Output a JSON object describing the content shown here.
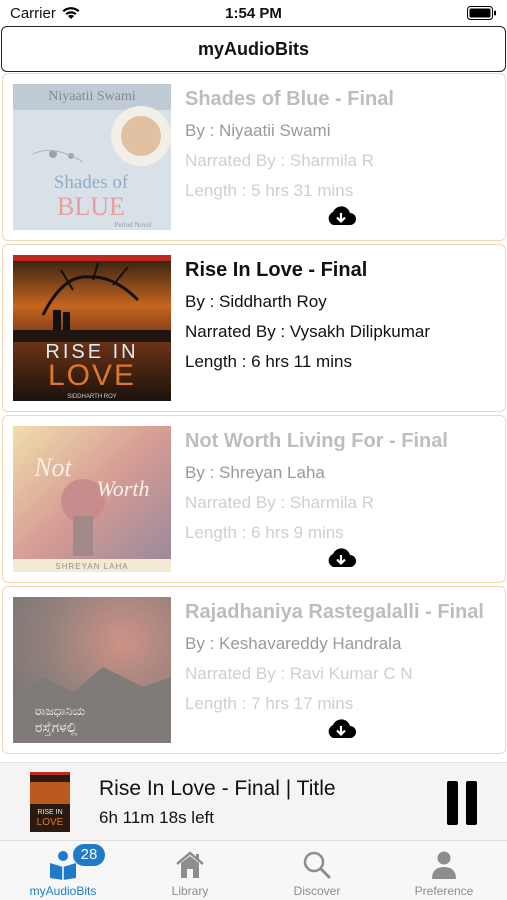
{
  "status_bar": {
    "carrier": "Carrier",
    "time": "1:54 PM"
  },
  "header": {
    "title": "myAudioBits"
  },
  "books": [
    {
      "title": "Shades of Blue - Final",
      "author": "By : Niyaatii Swami",
      "narrator": "Narrated By : Sharmila R",
      "length": "Length : 5 hrs 31 mins",
      "downloaded": false,
      "cover": {
        "top_text": "Niyaatii Swami",
        "title_line1": "Shades of",
        "title_line2": "BLUE",
        "byline": "Period Novel"
      }
    },
    {
      "title": "Rise In Love - Final",
      "author": "By : Siddharth Roy",
      "narrator": "Narrated By : Vysakh Dilipkumar",
      "length": "Length : 6 hrs 11 mins",
      "downloaded": true,
      "cover": {
        "title_line1": "RISE IN",
        "title_line2": "LOVE",
        "byline": "SIDDHARTH ROY"
      }
    },
    {
      "title": "Not Worth Living For - Final",
      "author": "By : Shreyan Laha",
      "narrator": "Narrated By : Sharmila R",
      "length": "Length : 6 hrs 9 mins",
      "downloaded": false,
      "cover": {
        "title_line1": "Not",
        "title_line2": "Worth",
        "byline": "SHREYAN LAHA"
      }
    },
    {
      "title": "Rajadhaniya Rastegalalli - Final",
      "author": "By : Keshavareddy Handrala",
      "narrator": "Narrated By : Ravi Kumar C N",
      "length": "Length : 7 hrs 17 mins",
      "downloaded": false,
      "cover": {
        "title_line1": "ರಾಜಧಾನಿಯ",
        "title_line2": "ರಸ್ತೆಗಳಲ್ಲಿ",
        "byline": ""
      }
    }
  ],
  "player": {
    "title": "Rise In Love - Final | Title",
    "time_left": "6h 11m 18s left",
    "cover": {
      "title_line1": "RISE IN",
      "title_line2": "LOVE"
    }
  },
  "tabs": [
    {
      "label": "myAudioBits",
      "icon": "reader-icon",
      "badge": "28",
      "active": true
    },
    {
      "label": "Library",
      "icon": "house-icon",
      "active": false
    },
    {
      "label": "Discover",
      "icon": "magnifier-icon",
      "active": false
    },
    {
      "label": "Preference",
      "icon": "person-icon",
      "active": false
    }
  ],
  "colors": {
    "accent": "#1f7bc9",
    "card_border": "#f3d6b4",
    "dim_text": "#bdbdbd"
  }
}
